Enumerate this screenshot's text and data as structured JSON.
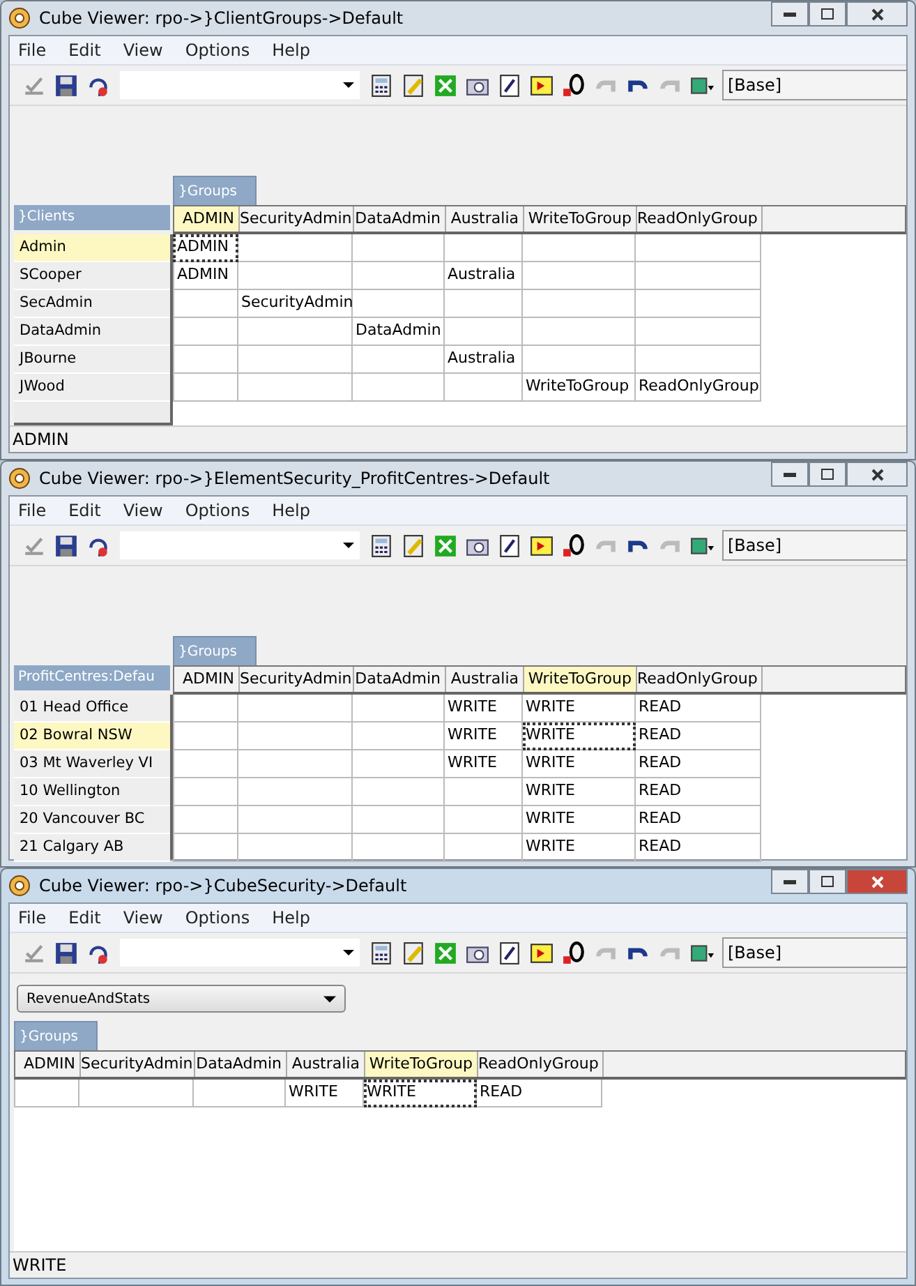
{
  "windows": [
    {
      "title": "Cube Viewer: rpo->}ClientGroups->Default",
      "active": false,
      "menu": [
        "File",
        "Edit",
        "View",
        "Options",
        "Help"
      ],
      "subset_field": "[Base]",
      "column_dimension": "}Groups",
      "row_dimension": "}Clients",
      "columns": [
        {
          "label": "ADMIN",
          "selected": true
        },
        {
          "label": "SecurityAdmin",
          "selected": false
        },
        {
          "label": "DataAdmin",
          "selected": false
        },
        {
          "label": "Australia",
          "selected": false
        },
        {
          "label": "WriteToGroup",
          "selected": false
        },
        {
          "label": "ReadOnlyGroup",
          "selected": false
        }
      ],
      "rows": [
        {
          "label": "Admin",
          "selected": true,
          "cells": [
            {
              "value": "ADMIN",
              "selected": true
            },
            {
              "selected": false
            },
            {
              "selected": false
            },
            {
              "selected": false
            },
            {
              "selected": false
            },
            {
              "selected": false
            }
          ]
        },
        {
          "label": "SCooper",
          "selected": false,
          "cells": [
            {
              "value": "ADMIN",
              "selected": false
            },
            {
              "selected": false
            },
            {
              "selected": false
            },
            {
              "value": "Australia",
              "selected": false
            },
            {
              "selected": false
            },
            {
              "selected": false
            }
          ]
        },
        {
          "label": "SecAdmin",
          "selected": false,
          "cells": [
            {
              "selected": false
            },
            {
              "value": "SecurityAdmin",
              "selected": false
            },
            {
              "selected": false
            },
            {
              "selected": false
            },
            {
              "selected": false
            },
            {
              "selected": false
            }
          ]
        },
        {
          "label": "DataAdmin",
          "selected": false,
          "cells": [
            {
              "selected": false
            },
            {
              "selected": false
            },
            {
              "value": "DataAdmin",
              "selected": false
            },
            {
              "selected": false
            },
            {
              "selected": false
            },
            {
              "selected": false
            }
          ]
        },
        {
          "label": "JBourne",
          "selected": false,
          "cells": [
            {
              "selected": false
            },
            {
              "selected": false
            },
            {
              "selected": false
            },
            {
              "value": "Australia",
              "selected": false
            },
            {
              "selected": false
            },
            {
              "selected": false
            }
          ]
        },
        {
          "label": "JWood",
          "selected": false,
          "cells": [
            {
              "selected": false
            },
            {
              "selected": false
            },
            {
              "selected": false
            },
            {
              "selected": false
            },
            {
              "value": "WriteToGroup",
              "selected": false
            },
            {
              "value": "ReadOnlyGroup",
              "selected": false
            }
          ]
        }
      ],
      "status_bar": "ADMIN"
    },
    {
      "title": "Cube Viewer: rpo->}ElementSecurity_ProfitCentres->Default",
      "active": false,
      "menu": [
        "File",
        "Edit",
        "View",
        "Options",
        "Help"
      ],
      "subset_field": "[Base]",
      "column_dimension": "}Groups",
      "row_dimension": "ProfitCentres:Defau",
      "columns": [
        {
          "label": "ADMIN",
          "selected": false
        },
        {
          "label": "SecurityAdmin",
          "selected": false
        },
        {
          "label": "DataAdmin",
          "selected": false
        },
        {
          "label": "Australia",
          "selected": false
        },
        {
          "label": "WriteToGroup",
          "selected": true
        },
        {
          "label": "ReadOnlyGroup",
          "selected": false
        }
      ],
      "rows": [
        {
          "label": "01 Head Office",
          "selected": false,
          "cells": [
            {
              "selected": false
            },
            {
              "selected": false
            },
            {
              "selected": false
            },
            {
              "value": "WRITE",
              "selected": false
            },
            {
              "value": "WRITE",
              "selected": false
            },
            {
              "value": "READ",
              "selected": false
            }
          ]
        },
        {
          "label": "02 Bowral NSW",
          "selected": true,
          "cells": [
            {
              "selected": false
            },
            {
              "selected": false
            },
            {
              "selected": false
            },
            {
              "value": "WRITE",
              "selected": false
            },
            {
              "value": "WRITE",
              "selected": true
            },
            {
              "value": "READ",
              "selected": false
            }
          ]
        },
        {
          "label": "03 Mt Waverley VI",
          "selected": false,
          "cells": [
            {
              "selected": false
            },
            {
              "selected": false
            },
            {
              "selected": false
            },
            {
              "value": "WRITE",
              "selected": false
            },
            {
              "value": "WRITE",
              "selected": false
            },
            {
              "value": "READ",
              "selected": false
            }
          ]
        },
        {
          "label": "10 Wellington",
          "selected": false,
          "cells": [
            {
              "selected": false
            },
            {
              "selected": false
            },
            {
              "selected": false
            },
            {
              "selected": false
            },
            {
              "value": "WRITE",
              "selected": false
            },
            {
              "value": "READ",
              "selected": false
            }
          ]
        },
        {
          "label": "20 Vancouver BC",
          "selected": false,
          "cells": [
            {
              "selected": false
            },
            {
              "selected": false
            },
            {
              "selected": false
            },
            {
              "selected": false
            },
            {
              "value": "WRITE",
              "selected": false
            },
            {
              "value": "READ",
              "selected": false
            }
          ]
        },
        {
          "label": "21 Calgary AB",
          "selected": false,
          "cells": [
            {
              "selected": false
            },
            {
              "selected": false
            },
            {
              "selected": false
            },
            {
              "selected": false
            },
            {
              "value": "WRITE",
              "selected": false
            },
            {
              "value": "READ",
              "selected": false
            }
          ]
        }
      ]
    },
    {
      "title": "Cube Viewer: rpo->}CubeSecurity->Default",
      "active": true,
      "menu": [
        "File",
        "Edit",
        "View",
        "Options",
        "Help"
      ],
      "subset_field": "[Base]",
      "title_selector": "RevenueAndStats",
      "column_dimension": "}Groups",
      "columns": [
        {
          "label": "ADMIN",
          "selected": false
        },
        {
          "label": "SecurityAdmin",
          "selected": false
        },
        {
          "label": "DataAdmin",
          "selected": false
        },
        {
          "label": "Australia",
          "selected": false
        },
        {
          "label": "WriteToGroup",
          "selected": true
        },
        {
          "label": "ReadOnlyGroup",
          "selected": false
        }
      ],
      "rows": [
        {
          "cells": [
            {
              "selected": false
            },
            {
              "selected": false
            },
            {
              "selected": false
            },
            {
              "value": "WRITE",
              "selected": false
            },
            {
              "value": "WRITE",
              "selected": true
            },
            {
              "value": "READ",
              "selected": false
            }
          ]
        }
      ],
      "status_bar": "WRITE"
    }
  ]
}
